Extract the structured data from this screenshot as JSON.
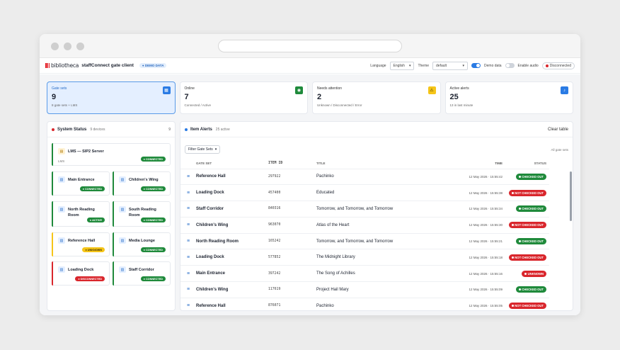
{
  "app": {
    "logo_text": "bibliotheca",
    "title": "staffConnect gate client",
    "demo_badge": "DEMO DATA",
    "language_label": "Language",
    "language_value": "English",
    "theme_label": "Theme",
    "theme_value": "default",
    "demo_data_label": "Demo data",
    "demo_data_on": true,
    "enable_audio_label": "Enable audio",
    "enable_audio_on": false,
    "connection_status": "Disconnected"
  },
  "stats": [
    {
      "label": "Gate sets",
      "value": "9",
      "sub": "8 gate sets + LMS",
      "icon": "gate-icon",
      "color": "#2a7be4"
    },
    {
      "label": "Online",
      "value": "7",
      "sub": "Connected / Active",
      "icon": "online-icon",
      "color": "#1f8a3b"
    },
    {
      "label": "Needs attention",
      "value": "2",
      "sub": "Unknown / Disconnected / Error",
      "icon": "warning-icon",
      "color": "#f5c518"
    },
    {
      "label": "Active alerts",
      "value": "25",
      "sub": "13 in last minute",
      "icon": "bell-icon",
      "color": "#2a7be4"
    }
  ],
  "system_status": {
    "title": "System Status",
    "devices_label": "9 devices",
    "count": "9",
    "devices": [
      {
        "name": "LMS — SIP2 Server",
        "sub": "LMS",
        "status": "CONNECTED",
        "tone": "green"
      },
      {
        "name": "Main Entrance",
        "status": "CONNECTED",
        "tone": "green"
      },
      {
        "name": "Children's Wing",
        "status": "CONNECTED",
        "tone": "green"
      },
      {
        "name": "North Reading Room",
        "status": "ACTIVE",
        "tone": "green"
      },
      {
        "name": "South Reading Room",
        "status": "CONNECTED",
        "tone": "green"
      },
      {
        "name": "Reference Hall",
        "status": "UNKNOWN",
        "tone": "amber"
      },
      {
        "name": "Media Lounge",
        "status": "CONNECTED",
        "tone": "green"
      },
      {
        "name": "Loading Dock",
        "status": "DISCONNECTED",
        "tone": "red"
      },
      {
        "name": "Staff Corridor",
        "status": "CONNECTED",
        "tone": "green"
      }
    ]
  },
  "alerts": {
    "title": "Item Alerts",
    "active_label": "25 active",
    "clear_label": "Clear table",
    "filter_label": "Filter Gate Sets",
    "all_label": "All gate sets",
    "columns": [
      "GATE SET",
      "ITEM ID",
      "TITLE",
      "TIME",
      "STATUS"
    ],
    "rows": [
      {
        "gate": "Reference Hall",
        "item": "297922",
        "title": "Pachinko",
        "time": "12 May 2026 · 15:55:42",
        "status": "CHECKED OUT",
        "kind": "out"
      },
      {
        "gate": "Loading Dock",
        "item": "457400",
        "title": "Educated",
        "time": "12 May 2026 · 15:55:38",
        "status": "NOT CHECKED OUT",
        "kind": "notout"
      },
      {
        "gate": "Staff Corridor",
        "item": "840316",
        "title": "Tomorrow, and Tomorrow, and Tomorrow",
        "time": "12 May 2026 · 15:55:34",
        "status": "CHECKED OUT",
        "kind": "out"
      },
      {
        "gate": "Children's Wing",
        "item": "963070",
        "title": "Atlas of the Heart",
        "time": "12 May 2026 · 15:55:30",
        "status": "NOT CHECKED OUT",
        "kind": "notout"
      },
      {
        "gate": "North Reading Room",
        "item": "165242",
        "title": "Tomorrow, and Tomorrow, and Tomorrow",
        "time": "12 May 2026 · 15:55:21",
        "status": "CHECKED OUT",
        "kind": "out"
      },
      {
        "gate": "Loading Dock",
        "item": "577852",
        "title": "The Midnight Library",
        "time": "12 May 2026 · 15:55:18",
        "status": "NOT CHECKED OUT",
        "kind": "notout"
      },
      {
        "gate": "Main Entrance",
        "item": "397242",
        "title": "The Song of Achilles",
        "time": "12 May 2026 · 15:55:16",
        "status": "UNKNOWN",
        "kind": "unknown"
      },
      {
        "gate": "Children's Wing",
        "item": "117619",
        "title": "Project Hail Mary",
        "time": "12 May 2026 · 15:55:09",
        "status": "CHECKED OUT",
        "kind": "out"
      },
      {
        "gate": "Reference Hall",
        "item": "876071",
        "title": "Pachinko",
        "time": "12 May 2026 · 15:55:05",
        "status": "NOT CHECKED OUT",
        "kind": "notout"
      }
    ]
  }
}
